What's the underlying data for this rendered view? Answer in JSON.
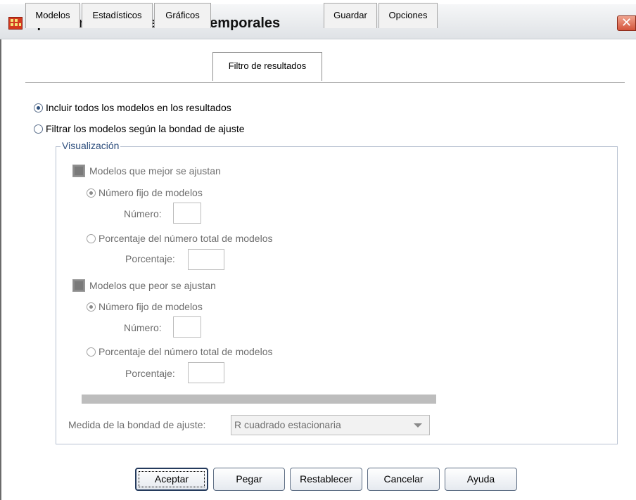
{
  "window": {
    "title": "Aplicar modelos de series temporales",
    "close_glyph": "✕"
  },
  "tabs": [
    {
      "label": "Modelos"
    },
    {
      "label": "Estadísticos"
    },
    {
      "label": "Gráficos"
    },
    {
      "label": "Filtro de resultados",
      "active": true
    },
    {
      "label": "Guardar"
    },
    {
      "label": "Opciones"
    }
  ],
  "filter": {
    "include_all": {
      "label": "Incluir todos los modelos en los resultados",
      "checked": true
    },
    "filter_fit": {
      "label": "Filtrar los modelos según la bondad de ajuste",
      "checked": false
    }
  },
  "display": {
    "title": "Visualización",
    "best": {
      "label": "Modelos que mejor se ajustan",
      "fixed_label": "Número fijo de modelos",
      "number_label": "Número:",
      "percent_label": "Porcentaje del número total de modelos",
      "percentage_label": "Porcentaje:"
    },
    "worst": {
      "label": "Modelos que peor se ajustan",
      "fixed_label": "Número fijo de modelos",
      "number_label": "Número:",
      "percent_label": "Porcentaje del número total de modelos",
      "percentage_label": "Porcentaje:"
    },
    "measure_label": "Medida de la bondad de ajuste:",
    "measure_value": "R cuadrado estacionaria"
  },
  "buttons": {
    "ok": "Aceptar",
    "paste": "Pegar",
    "reset": "Restablecer",
    "cancel": "Cancelar",
    "help": "Ayuda"
  },
  "colors": {
    "accent": "#2d4e7d",
    "close": "#d4543b"
  }
}
